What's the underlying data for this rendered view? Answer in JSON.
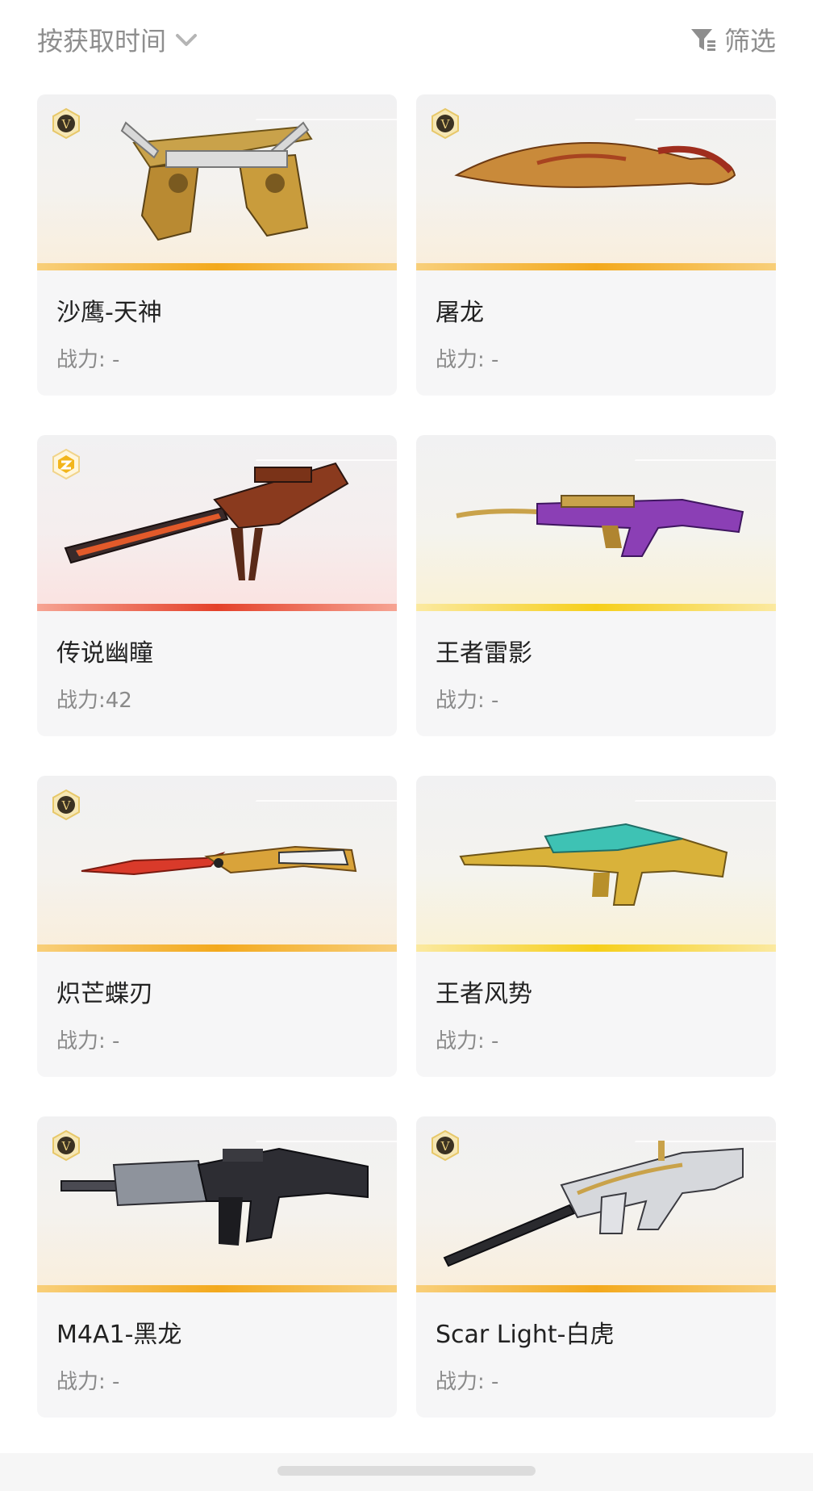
{
  "toolbar": {
    "sort_label": "按获取时间",
    "sort_icon": "chevron-down-icon",
    "filter_label": "筛选",
    "filter_icon": "funnel-icon"
  },
  "colors": {
    "gold_stripe": "#f3a91d",
    "yellow_stripe": "#f6cf1a",
    "red_stripe": "#e4412a",
    "label_gray": "#8e8e8e"
  },
  "cards": [
    {
      "name": "沙鹰-天神",
      "power": "战力: -",
      "rarity": "gold",
      "badge": "v-badge"
    },
    {
      "name": "屠龙",
      "power": "战力: -",
      "rarity": "gold",
      "badge": "v-badge"
    },
    {
      "name": "传说幽瞳",
      "power": "战力:42",
      "rarity": "red",
      "badge": "legend-badge"
    },
    {
      "name": "王者雷影",
      "power": "战力: -",
      "rarity": "yellow",
      "badge": ""
    },
    {
      "name": "炽芒蝶刃",
      "power": "战力: -",
      "rarity": "gold",
      "badge": "v-badge"
    },
    {
      "name": "王者风势",
      "power": "战力: -",
      "rarity": "yellow",
      "badge": ""
    },
    {
      "name": "M4A1-黑龙",
      "power": "战力: -",
      "rarity": "gold",
      "badge": "v-badge"
    },
    {
      "name": "Scar Light-白虎",
      "power": "战力: -",
      "rarity": "gold",
      "badge": "v-badge"
    }
  ]
}
